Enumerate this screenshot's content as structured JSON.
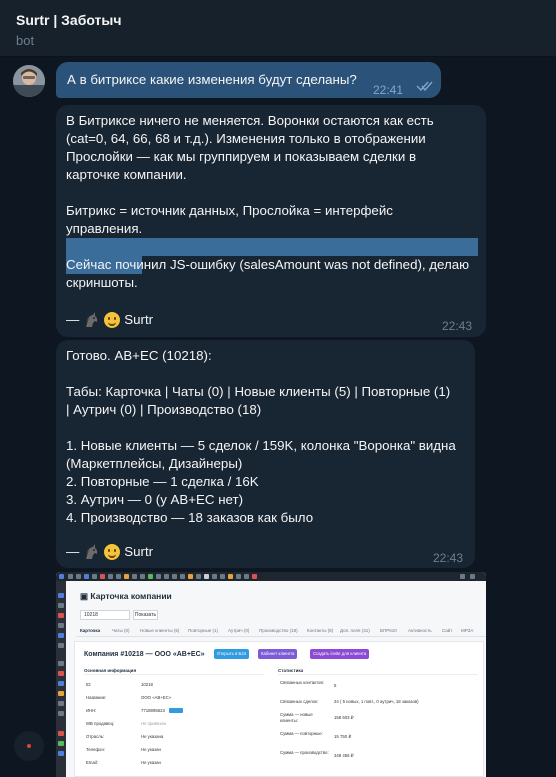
{
  "header": {
    "title": "Surtr | Заботыч",
    "subtitle": "bot"
  },
  "messages": {
    "outgoing": {
      "text": "А в битриксе какие изменения будут сделаны?",
      "time": "22:41"
    },
    "reply1": {
      "lines": [
        "В Битриксе ничего не меняется. Воронки остаются как есть",
        "(cat=0, 64, 66, 68 и т.д.). Изменения только в отображении",
        "Прослойки — как мы группируем и показываем сделки в",
        "карточке компании.",
        "Битрикс = источник данных, Прослойка = интерфейс",
        "управления.",
        "Сейчас починил JS-ошибку (salesAmount was not defined), делаю",
        "скриншоты."
      ],
      "sign_prefix": "—",
      "sign_name": "Surtr",
      "time": "22:43"
    },
    "reply2": {
      "lines": [
        "Готово. АВ+ЕС (10218):",
        "Табы: Карточка | Чаты (0) | Новые клиенты (5) | Повторные (1)",
        "| Аутрич (0) | Производство (18)",
        "1. Новые клиенты — 5 сделок / 159K, колонка \"Воронка\" видна",
        "(Маркетплейсы, Дизайнеры)",
        "2. Повторные — 1 сделка / 16K",
        "3. Аутрич — 0 (у АВ+ЕС нет)",
        "4. Производство — 18 заказов как было"
      ],
      "sign_prefix": "—",
      "sign_name": "Surtr",
      "time": "22:43"
    }
  },
  "screenshot": {
    "page_title": "Карточка компании",
    "search_value": "10218",
    "search_button": "Показать",
    "tabs": [
      "Карточка",
      "Чаты (0)",
      "Новые клиенты (5)",
      "Повторные (1)",
      "Аутрич (0)",
      "Производство (18)",
      "Контакты (8)",
      "Доп. поля (31)",
      "БПР610",
      "Активность",
      "Сайт",
      "МРЗА"
    ],
    "company_heading": "Компания #10218 — ООО «АВ+ЕС»",
    "buttons": [
      "Открыть в Б24",
      "Кабинет клиента",
      "Создать invite для клиента"
    ],
    "button_colors": [
      "#2f9be0",
      "#7b5cd6",
      "#8c4bd4"
    ],
    "left_section": "Основная информация",
    "right_section": "Статистика",
    "left_rows": [
      {
        "label": "ID:",
        "value": "10218"
      },
      {
        "label": "Название:",
        "value": "ООО «АВ+ЕС»"
      },
      {
        "label": "ИНН:",
        "value": "7718895623"
      },
      {
        "label": "WB продавец:",
        "value": "Не привязан"
      },
      {
        "label": "Отрасль:",
        "value": "Не указана"
      },
      {
        "label": "Телефон:",
        "value": "Не указан"
      },
      {
        "label": "Email:",
        "value": "Не указан"
      }
    ],
    "right_rows": [
      {
        "label": "Связанных контактов:",
        "value": "5"
      },
      {
        "label": "Связанных сделок:",
        "value": "24 ( 5 новых, 1 повт., 0 аутрич, 18 заказов)"
      },
      {
        "label": "Сумма — новые клиенты:",
        "value": "158 603 ₽"
      },
      {
        "label": "Сумма — повторные:",
        "value": "15 750 ₽"
      },
      {
        "label": "Сумма — производство:",
        "value": "348 455 ₽"
      }
    ]
  }
}
